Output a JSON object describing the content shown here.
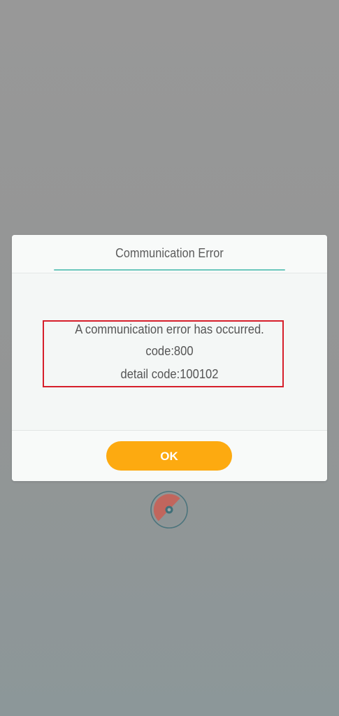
{
  "dialog": {
    "title": "Communication Error",
    "message_lines": [
      "A communication error has occurred.",
      "code:800",
      "detail code:100102"
    ],
    "ok_label": "OK"
  },
  "colors": {
    "accent_underline": "#6cc7bd",
    "button": "#fdaa10",
    "highlight_border": "#d61f2b",
    "loader_ring": "#3f6f78",
    "loader_segment": "#c1665d"
  },
  "icons": {
    "loader": "loading-spinner-icon"
  }
}
